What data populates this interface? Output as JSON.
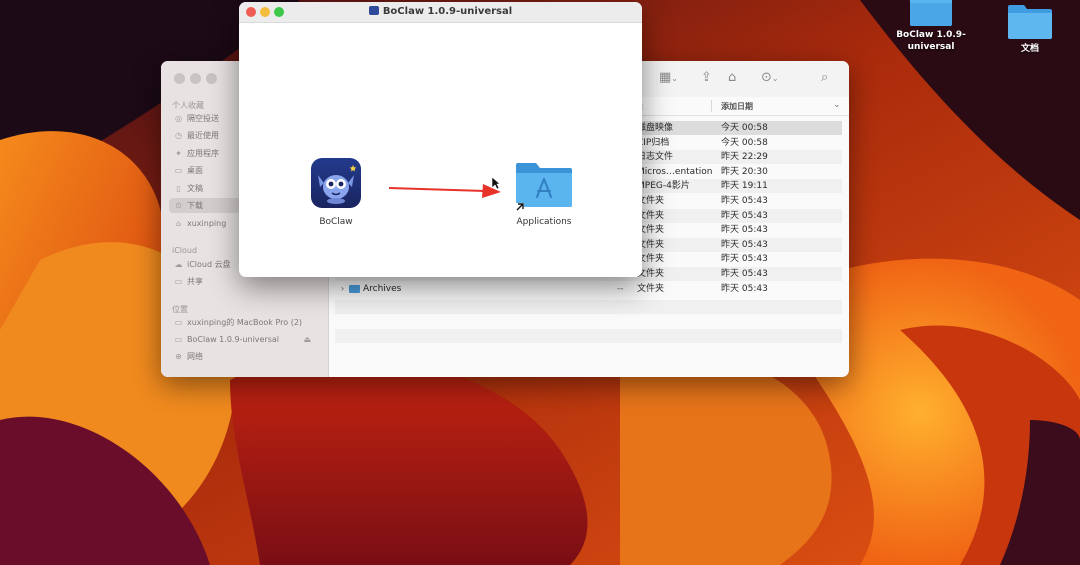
{
  "desktop": {
    "icons": [
      {
        "label": "BoClaw 1.0.9-universal",
        "icon": "folder-icon"
      },
      {
        "label": "文档",
        "icon": "folder-icon"
      }
    ]
  },
  "finder": {
    "sidebar": {
      "favorites_title": "个人收藏",
      "favorites": [
        {
          "label": "隔空投送",
          "icon": "airdrop-icon"
        },
        {
          "label": "最近使用",
          "icon": "clock-icon"
        },
        {
          "label": "应用程序",
          "icon": "apps-icon"
        },
        {
          "label": "桌面",
          "icon": "desktop-icon"
        },
        {
          "label": "文稿",
          "icon": "document-icon"
        },
        {
          "label": "下载",
          "icon": "download-icon"
        },
        {
          "label": "xuxinping",
          "icon": "home-icon"
        }
      ],
      "icloud_title": "iCloud",
      "icloud": [
        {
          "label": "iCloud 云盘",
          "icon": "cloud-icon"
        },
        {
          "label": "共享",
          "icon": "shared-folder-icon"
        }
      ],
      "locations_title": "位置",
      "locations": [
        {
          "label": "xuxinping的 MacBook Pro (2)",
          "icon": "laptop-icon"
        },
        {
          "label": "BoClaw 1.0.9-universal",
          "icon": "disk-icon"
        },
        {
          "label": "网络",
          "icon": "network-icon"
        }
      ]
    },
    "columns": {
      "kind": "类",
      "date": "添加日期"
    },
    "rows": [
      {
        "kind": "磁盘映像",
        "date": "今天 00:58"
      },
      {
        "kind": "ZIP归档",
        "date": "今天 00:58"
      },
      {
        "kind": "日志文件",
        "date": "昨天 22:29"
      },
      {
        "kind": "Micros…entation",
        "date": "昨天 20:30"
      },
      {
        "kind": "MPEG-4影片",
        "date": "昨天 19:11"
      },
      {
        "kind": "文件夹",
        "date": "昨天 05:43"
      },
      {
        "kind": "文件夹",
        "date": "昨天 05:43"
      },
      {
        "kind": "文件夹",
        "date": "昨天 05:43"
      },
      {
        "kind": "文件夹",
        "date": "昨天 05:43"
      },
      {
        "kind": "文件夹",
        "date": "昨天 05:43"
      },
      {
        "kind": "文件夹",
        "date": "昨天 05:43"
      },
      {
        "name": "Archives",
        "size": "--",
        "kind": "文件夹",
        "date": "昨天 05:43"
      }
    ]
  },
  "dmg": {
    "title": "BoClaw 1.0.9-universal",
    "app_label": "BoClaw",
    "target_label": "Applications"
  },
  "colors": {
    "accent_folder": "#4aaae9",
    "arrow": "#e8332a",
    "close": "#ee5c54",
    "minimize": "#f4bd3d",
    "zoom": "#3ec84a"
  }
}
